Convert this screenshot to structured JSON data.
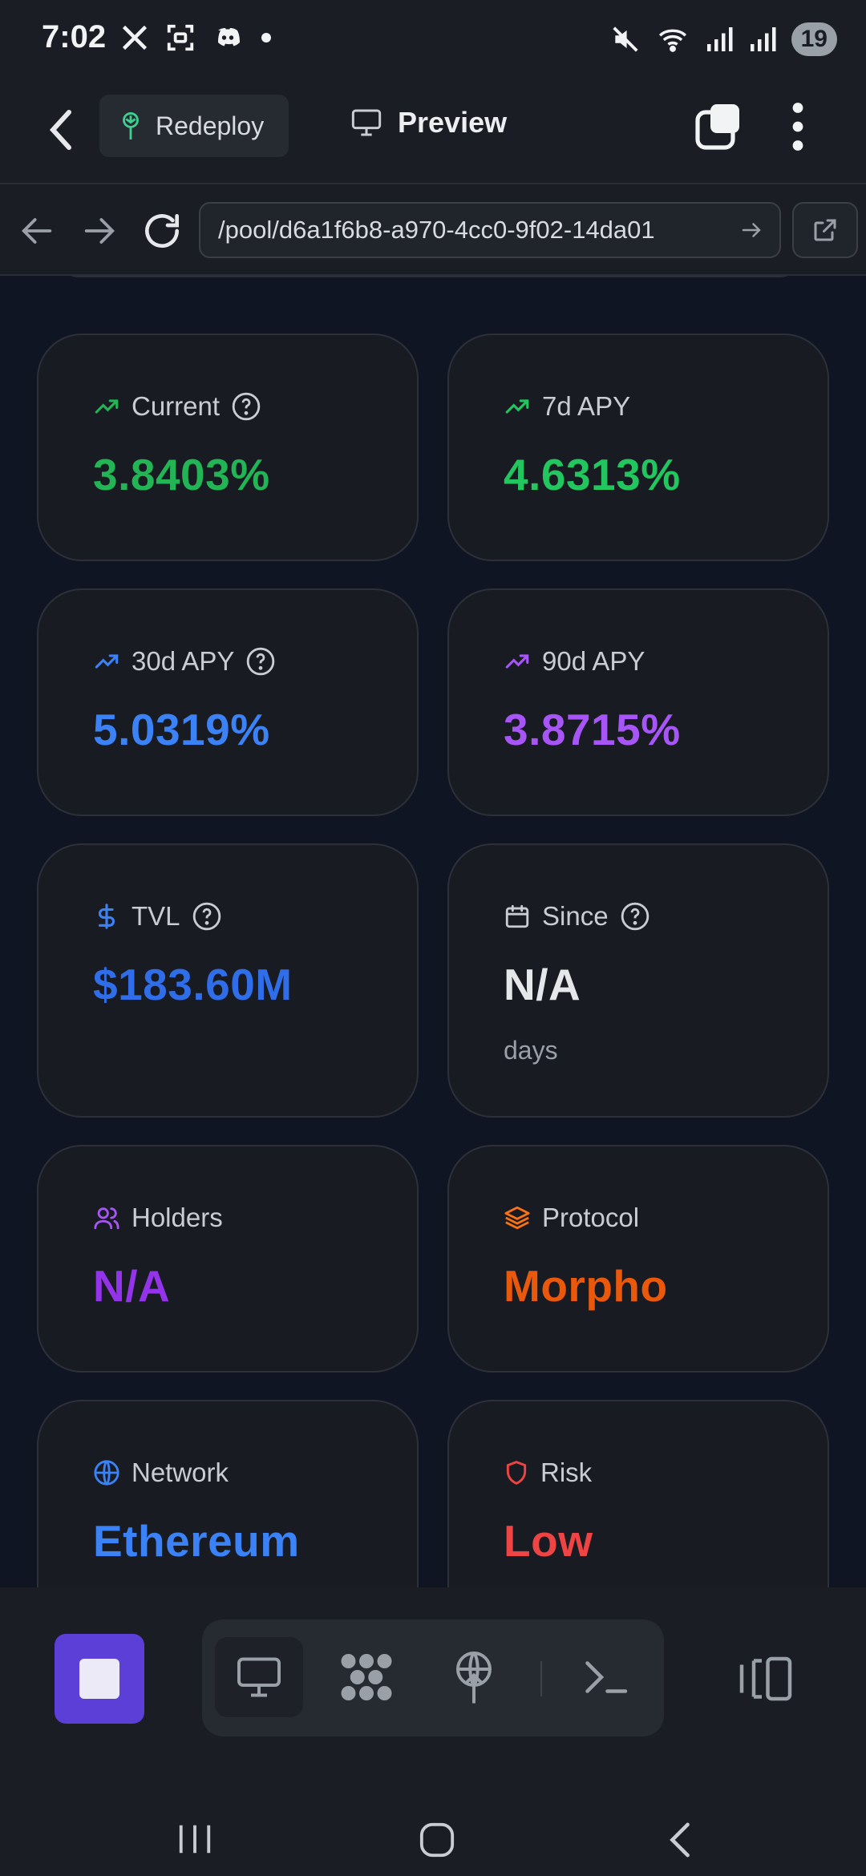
{
  "status_bar": {
    "time": "7:02",
    "battery": "19"
  },
  "toolbar": {
    "redeploy_label": "Redeploy",
    "preview_label": "Preview"
  },
  "browser": {
    "url": "/pool/d6a1f6b8-a970-4cc0-9f02-14da01"
  },
  "stats": [
    {
      "label": "Current",
      "value": "3.8403%",
      "value_color": "#22b455",
      "icon": "trending-up-icon",
      "icon_color": "#22b455",
      "info": true
    },
    {
      "label": "7d APY",
      "value": "4.6313%",
      "value_color": "#22c55e",
      "icon": "trending-up-icon",
      "icon_color": "#22c55e",
      "info": false
    },
    {
      "label": "30d APY",
      "value": "5.0319%",
      "value_color": "#3b82f6",
      "icon": "trending-up-icon",
      "icon_color": "#3b82f6",
      "info": true
    },
    {
      "label": "90d APY",
      "value": "3.8715%",
      "value_color": "#a855f7",
      "icon": "trending-up-icon",
      "icon_color": "#a855f7",
      "info": false
    },
    {
      "label": "TVL",
      "value": "$183.60M",
      "value_color": "#2563eb",
      "icon": "dollar-icon",
      "icon_color": "#3b82f6",
      "info": true
    },
    {
      "label": "Since",
      "value": "N/A",
      "sub": "days",
      "value_color": "#e5e7eb",
      "icon": "calendar-icon",
      "icon_color": "#c9ccd2",
      "info": true
    },
    {
      "label": "Holders",
      "value": "N/A",
      "value_color": "#9333ea",
      "icon": "users-icon",
      "icon_color": "#a855f7",
      "info": false
    },
    {
      "label": "Protocol",
      "value": "Morpho",
      "value_color": "#ea580c",
      "icon": "layers-icon",
      "icon_color": "#f97316",
      "info": false
    },
    {
      "label": "Network",
      "value": "Ethereum",
      "value_color": "#3b82f6",
      "icon": "globe-icon",
      "icon_color": "#3b82f6",
      "info": false
    },
    {
      "label": "Risk",
      "value": "Low",
      "value_color": "#ef4444",
      "icon": "shield-icon",
      "icon_color": "#ef4444",
      "info": false
    }
  ]
}
